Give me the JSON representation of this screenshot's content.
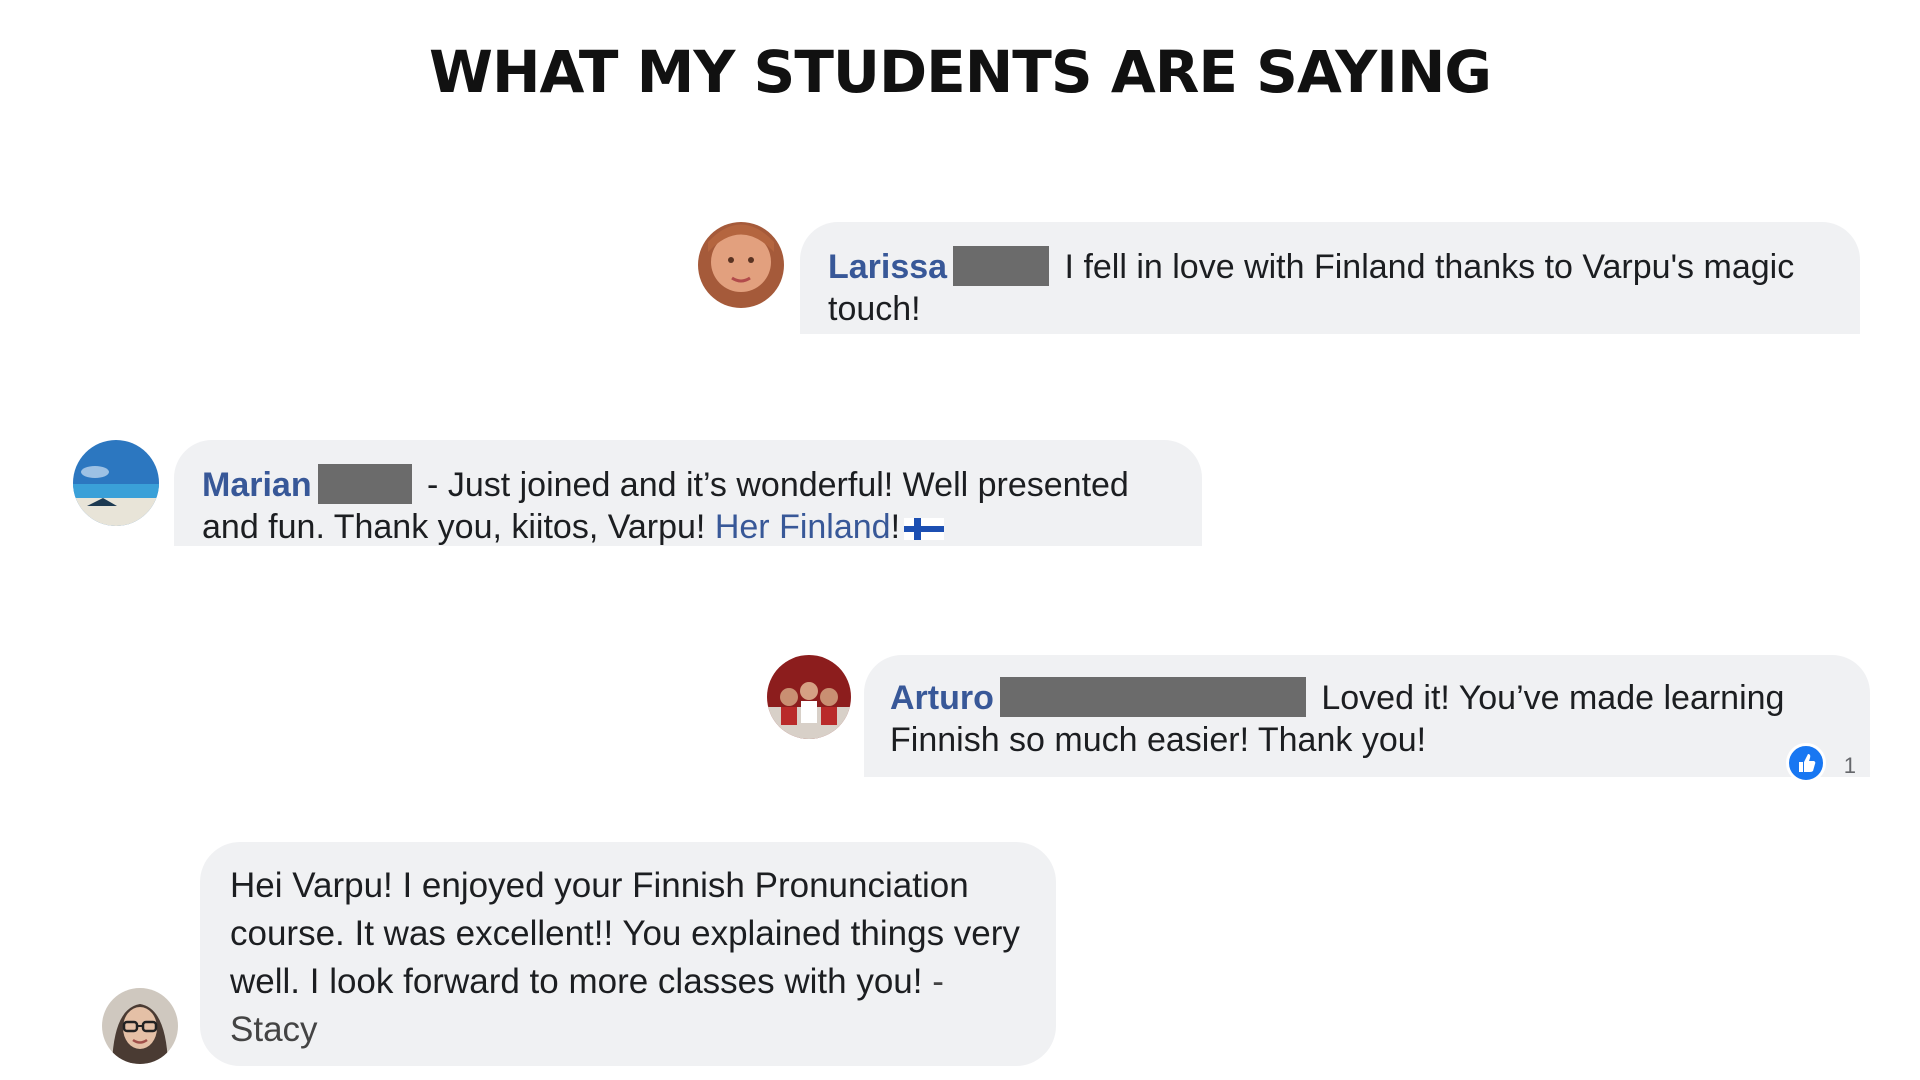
{
  "title": "WHAT MY STUDENTS ARE SAYING",
  "testimonials": [
    {
      "name": "Larissa",
      "text": "I fell in love with Finland thanks to Varpu's magic touch!"
    },
    {
      "name": "Marian",
      "text": "- Just joined and it’s wonderful! Well presented and fun. Thank you, kiitos, Varpu!",
      "link": "Her Finland",
      "suffix": "!"
    },
    {
      "name": "Arturo",
      "text": "Loved it! You’ve made learning Finnish so much easier! Thank you!",
      "reaction_count": "1"
    },
    {
      "text": "Hei Varpu! I enjoyed your Finnish Pronunciation course. It was excellent!! You explained things very well. I look forward to more classes with you!",
      "signature": "- Stacy"
    }
  ],
  "colors": {
    "bubble": "#f0f1f3",
    "name": "#385898",
    "redaction": "#6b6b6b",
    "reaction": "#1877f2"
  },
  "icons": {
    "reaction": "like-icon",
    "flag": "finland-flag-icon"
  }
}
